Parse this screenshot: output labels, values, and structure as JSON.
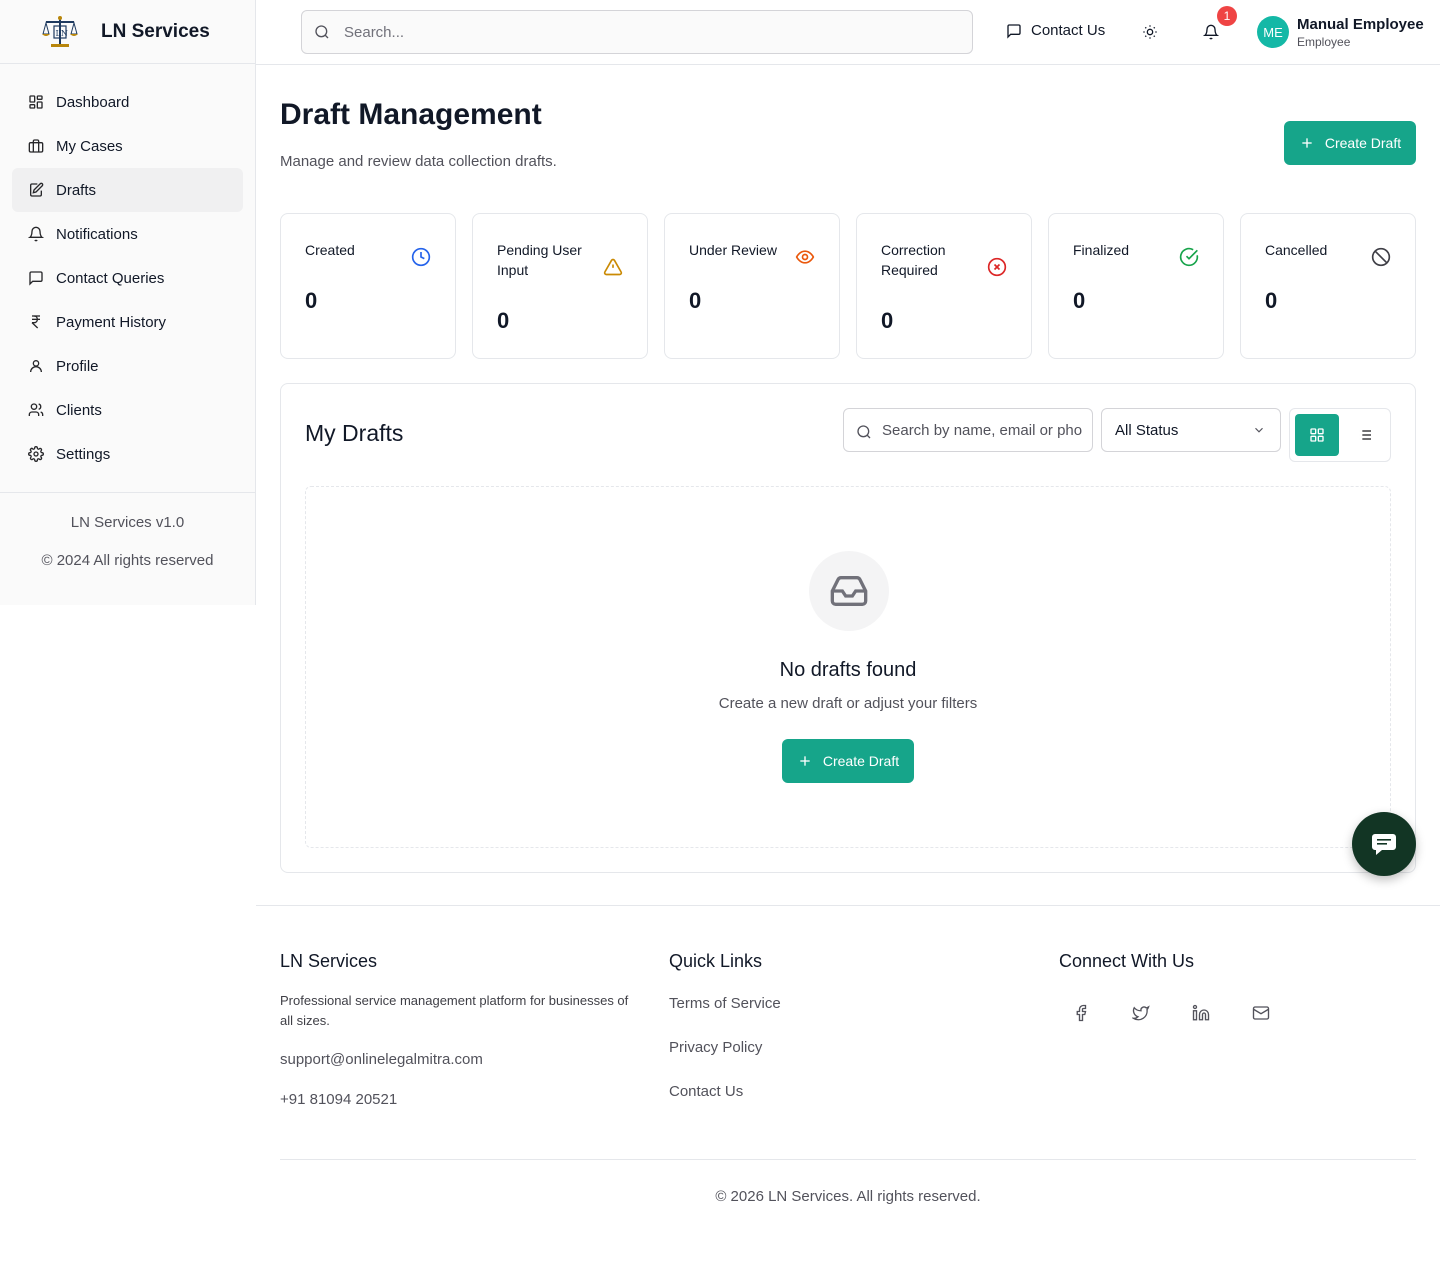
{
  "brand": {
    "name": "LN Services",
    "logo_icon": "scales-of-justice-logo"
  },
  "sidebar": {
    "items": [
      {
        "label": "Dashboard",
        "icon": "dashboard-icon",
        "active": false
      },
      {
        "label": "My Cases",
        "icon": "briefcase-icon",
        "active": false
      },
      {
        "label": "Drafts",
        "icon": "edit-document-icon",
        "active": true
      },
      {
        "label": "Notifications",
        "icon": "bell-icon",
        "active": false
      },
      {
        "label": "Contact Queries",
        "icon": "message-icon",
        "active": false
      },
      {
        "label": "Payment History",
        "icon": "rupee-icon",
        "active": false
      },
      {
        "label": "Profile",
        "icon": "user-icon",
        "active": false
      },
      {
        "label": "Clients",
        "icon": "users-icon",
        "active": false
      },
      {
        "label": "Settings",
        "icon": "gear-icon",
        "active": false
      }
    ],
    "version": "LN Services v1.0",
    "copyright": "© 2024 All rights reserved"
  },
  "header": {
    "search_placeholder": "Search...",
    "contact_label": "Contact Us",
    "notification_count": "1",
    "user": {
      "initials": "ME",
      "name": "Manual Employee",
      "role": "Employee"
    }
  },
  "main": {
    "title": "Draft Management",
    "subtitle": "Manage and review data collection drafts.",
    "create_label": "Create Draft",
    "stats": [
      {
        "label": "Created",
        "value": "0",
        "icon": "clock-icon",
        "color": "#2563eb"
      },
      {
        "label": "Pending User Input",
        "value": "0",
        "icon": "warning-icon",
        "color": "#ca8a04"
      },
      {
        "label": "Under Review",
        "value": "0",
        "icon": "eye-icon",
        "color": "#ea580c"
      },
      {
        "label": "Correction Required",
        "value": "0",
        "icon": "x-circle-icon",
        "color": "#dc2626"
      },
      {
        "label": "Finalized",
        "value": "0",
        "icon": "check-circle-icon",
        "color": "#16a34a"
      },
      {
        "label": "Cancelled",
        "value": "0",
        "icon": "ban-icon",
        "color": "#3f3f46"
      }
    ],
    "drafts": {
      "title": "My Drafts",
      "search_placeholder": "Search by name, email or phone",
      "status_selected": "All Status",
      "empty_title": "No drafts found",
      "empty_subtitle": "Create a new draft or adjust your filters",
      "empty_button": "Create Draft"
    }
  },
  "footer": {
    "about_title": "LN Services",
    "about_text": "Professional service management platform for businesses of all sizes.",
    "email": "support@onlinelegalmitra.com",
    "phone": "+91 81094 20521",
    "links_title": "Quick Links",
    "links": [
      "Terms of Service",
      "Privacy Policy",
      "Contact Us"
    ],
    "connect_title": "Connect With Us",
    "copyright": "© 2026 LN Services. All rights reserved."
  },
  "colors": {
    "accent": "#16a58a",
    "chat_fab": "#123524",
    "badge": "#ef4444"
  }
}
